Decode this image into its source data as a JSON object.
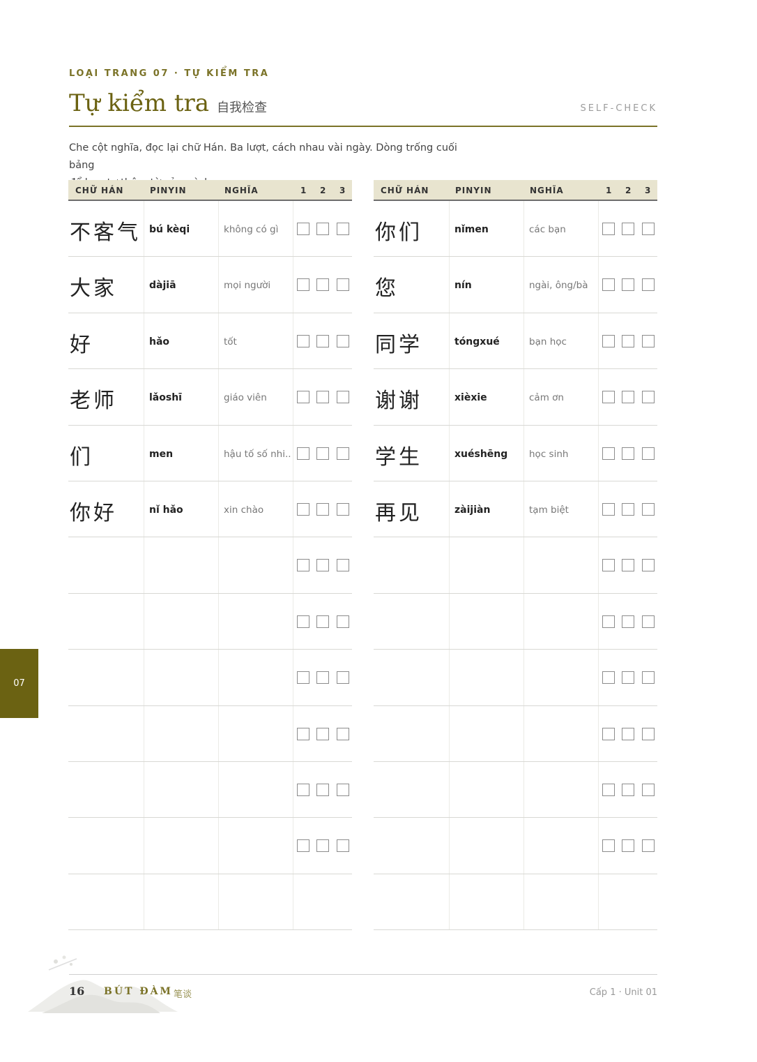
{
  "header": {
    "eyebrow": "LOẠI TRANG 07 · TỰ KIỂM TRA",
    "title": "Tự kiểm tra",
    "title_zh": "自我检查",
    "self_check": "SELF-CHECK"
  },
  "instructions": {
    "line1": "Che cột nghĩa, đọc lại chữ Hán. Ba lượt, cách nhau vài ngày. Dòng trống cuối bảng",
    "line2": "để bạn tự thêm từ của mình."
  },
  "columns": {
    "hanzi": "CHỮ HÁN",
    "pinyin": "PINYIN",
    "meaning": "NGHĨA",
    "c1": "1",
    "c2": "2",
    "c3": "3"
  },
  "left_rows": [
    {
      "hanzi": "不客气",
      "pinyin": "bú kèqi",
      "meaning": "không có gì"
    },
    {
      "hanzi": "大家",
      "pinyin": "dàjiā",
      "meaning": "mọi người"
    },
    {
      "hanzi": "好",
      "pinyin": "hǎo",
      "meaning": "tốt"
    },
    {
      "hanzi": "老师",
      "pinyin": "lǎoshī",
      "meaning": "giáo viên"
    },
    {
      "hanzi": "们",
      "pinyin": "men",
      "meaning": "hậu tố số nhi..."
    },
    {
      "hanzi": "你好",
      "pinyin": "nǐ hǎo",
      "meaning": "xin chào"
    }
  ],
  "right_rows": [
    {
      "hanzi": "你们",
      "pinyin": "nǐmen",
      "meaning": "các bạn"
    },
    {
      "hanzi": "您",
      "pinyin": "nín",
      "meaning": "ngài, ông/bà"
    },
    {
      "hanzi": "同学",
      "pinyin": "tóngxué",
      "meaning": "bạn học"
    },
    {
      "hanzi": "谢谢",
      "pinyin": "xièxie",
      "meaning": "cảm ơn"
    },
    {
      "hanzi": "学生",
      "pinyin": "xuéshēng",
      "meaning": "học sinh"
    },
    {
      "hanzi": "再见",
      "pinyin": "zàijiàn",
      "meaning": "tạm biệt"
    }
  ],
  "side_tab": "07",
  "footer": {
    "page_number": "16",
    "brand": "BÚT ĐÀM",
    "brand_zh": "笔谈",
    "right": "Cấp 1 · Unit 01"
  }
}
